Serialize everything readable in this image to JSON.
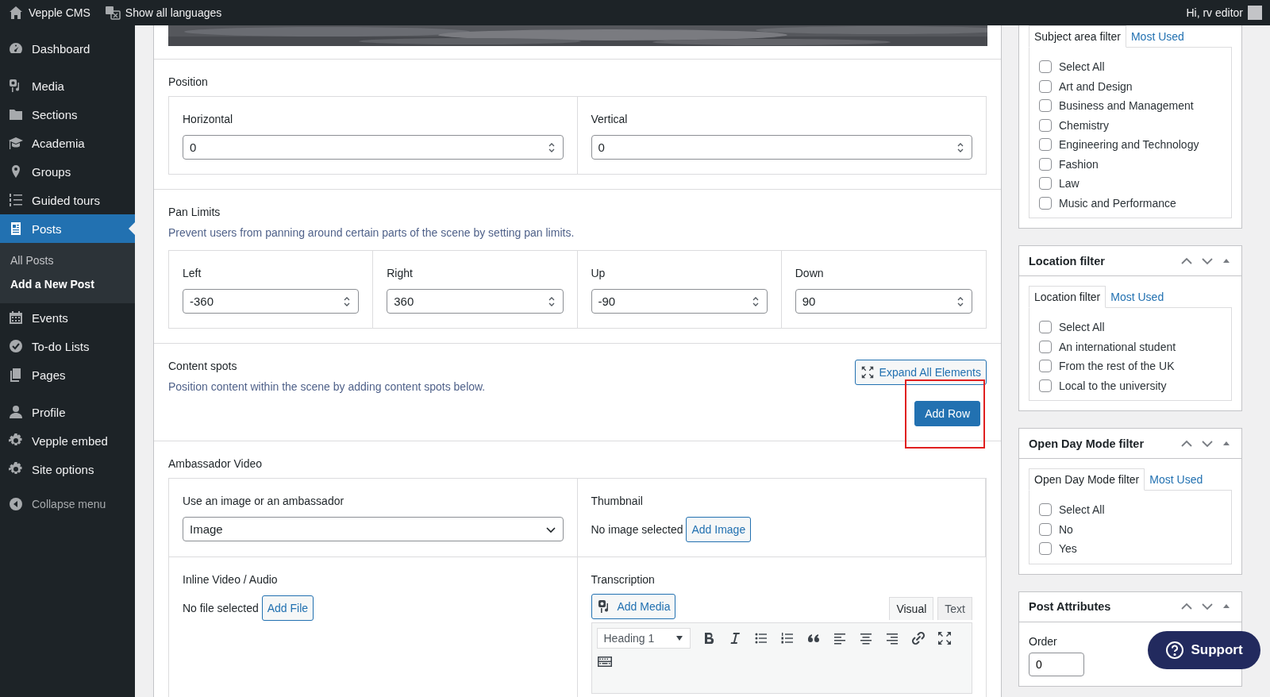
{
  "admin_bar": {
    "site": "Vepple CMS",
    "languages": "Show all languages",
    "greeting": "Hi, rv editor"
  },
  "sidebar": {
    "groups": [
      [
        {
          "label": "Dashboard",
          "selected": false
        }
      ],
      [
        {
          "label": "Media",
          "selected": false
        },
        {
          "label": "Sections",
          "selected": false
        },
        {
          "label": "Academia",
          "selected": false
        },
        {
          "label": "Groups",
          "selected": false
        },
        {
          "label": "Guided tours",
          "selected": false
        },
        {
          "label": "Posts",
          "selected": true,
          "children": [
            {
              "label": "All Posts",
              "selected": false
            },
            {
              "label": "Add a New Post",
              "selected": true
            }
          ]
        },
        {
          "label": "Events",
          "selected": false
        },
        {
          "label": "To-do Lists",
          "selected": false
        },
        {
          "label": "Pages",
          "selected": false
        }
      ],
      [
        {
          "label": "Profile",
          "selected": false
        },
        {
          "label": "Vepple embed",
          "selected": false
        },
        {
          "label": "Site options",
          "selected": false
        }
      ]
    ],
    "collapse": "Collapse menu"
  },
  "position": {
    "title": "Position",
    "fields": [
      {
        "label": "Horizontal",
        "value": "0"
      },
      {
        "label": "Vertical",
        "value": "0"
      }
    ]
  },
  "pan_limits": {
    "title": "Pan Limits",
    "description": "Prevent users from panning around certain parts of the scene by setting pan limits.",
    "fields": [
      {
        "label": "Left",
        "value": "-360"
      },
      {
        "label": "Right",
        "value": "360"
      },
      {
        "label": "Up",
        "value": "-90"
      },
      {
        "label": "Down",
        "value": "90"
      }
    ]
  },
  "content_spots": {
    "title": "Content spots",
    "description": "Position content within the scene by adding content spots below.",
    "expand_button": "Expand All Elements",
    "add_button": "Add Row",
    "highlighted": true
  },
  "ambassador_video": {
    "title": "Ambassador Video",
    "source": {
      "label": "Use an image or an ambassador",
      "value": "Image"
    },
    "thumbnail": {
      "label": "Thumbnail",
      "status": "No image selected",
      "button": "Add Image"
    },
    "inline_media": {
      "label": "Inline Video / Audio",
      "status": "No file selected",
      "button": "Add File"
    },
    "transcription": {
      "label": "Transcription",
      "add_media": "Add Media",
      "tabs": [
        {
          "label": "Visual",
          "selected": true
        },
        {
          "label": "Text",
          "selected": false
        }
      ],
      "format": "Heading 1",
      "toolbar": [
        {
          "kind": "bold"
        },
        {
          "kind": "italic"
        },
        {
          "kind": "bullets"
        },
        {
          "kind": "numbers"
        },
        {
          "kind": "quote"
        },
        {
          "kind": "align-left"
        },
        {
          "kind": "align-center"
        },
        {
          "kind": "align-right"
        },
        {
          "kind": "link"
        },
        {
          "kind": "fullscreen"
        },
        {
          "kind": "keyboard"
        }
      ]
    }
  },
  "filters": [
    {
      "tabs": [
        {
          "label": "Subject area filter",
          "selected": true
        },
        {
          "label": "Most Used",
          "selected": false
        }
      ],
      "options": [
        {
          "label": "Select All",
          "checked": false
        },
        {
          "label": "Art and Design",
          "checked": false
        },
        {
          "label": "Business and Management",
          "checked": false
        },
        {
          "label": "Chemistry",
          "checked": false
        },
        {
          "label": "Engineering and Technology",
          "checked": false
        },
        {
          "label": "Fashion",
          "checked": false
        },
        {
          "label": "Law",
          "checked": false
        },
        {
          "label": "Music and Performance",
          "checked": false
        }
      ]
    },
    {
      "title": "Location filter",
      "tabs": [
        {
          "label": "Location filter",
          "selected": true
        },
        {
          "label": "Most Used",
          "selected": false
        }
      ],
      "options": [
        {
          "label": "Select All",
          "checked": false
        },
        {
          "label": "An international student",
          "checked": false
        },
        {
          "label": "From the rest of the UK",
          "checked": false
        },
        {
          "label": "Local to the university",
          "checked": false
        }
      ]
    },
    {
      "title": "Open Day Mode filter",
      "tabs": [
        {
          "label": "Open Day Mode filter",
          "selected": true
        },
        {
          "label": "Most Used",
          "selected": false
        }
      ],
      "options": [
        {
          "label": "Select All",
          "checked": false
        },
        {
          "label": "No",
          "checked": false
        },
        {
          "label": "Yes",
          "checked": false
        }
      ]
    }
  ],
  "post_attributes": {
    "title": "Post Attributes",
    "order_label": "Order",
    "order_value": "0"
  },
  "support_button": "Support"
}
